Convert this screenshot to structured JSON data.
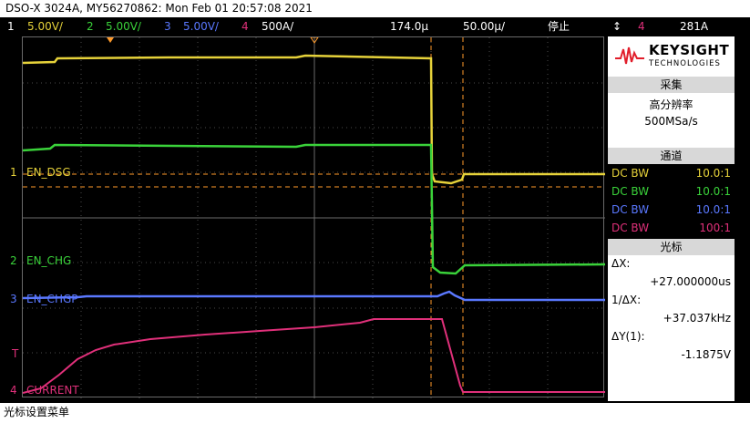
{
  "title": "DSO-X 3024A, MY56270862: Mon Feb 01 20:57:08 2021",
  "channel_bar": {
    "ch1_num": "1",
    "ch1_scale": "5.00V/",
    "ch2_num": "2",
    "ch2_scale": "5.00V/",
    "ch3_num": "3",
    "ch3_scale": "5.00V/",
    "ch4_num": "4",
    "ch4_scale": "500A/",
    "time_delay": "174.0µ",
    "time_scale": "50.00µ/",
    "run_state": "停止",
    "trigger_icon": "↕",
    "trigger_channel": "4",
    "trigger_level": "281A"
  },
  "traces": {
    "ch1": "EN_DSG",
    "ch2": "EN_CHG",
    "ch3": "EN_CHGP",
    "ch4": "CURRENT",
    "marker1": "1",
    "marker2": "2",
    "marker3": "3",
    "marker4": "4",
    "trig_marker": "T"
  },
  "brand": {
    "name": "KEYSIGHT",
    "sub": "TECHNOLOGIES"
  },
  "acquisition": {
    "header": "采集",
    "mode": "高分辨率",
    "rate": "500MSa/s"
  },
  "channels": {
    "header": "通道",
    "rows": [
      {
        "coupling": "DC BW",
        "probe": "10.0:1",
        "color": "#e6d23a"
      },
      {
        "coupling": "DC BW",
        "probe": "10.0:1",
        "color": "#3ad23a"
      },
      {
        "coupling": "DC BW",
        "probe": "10.0:1",
        "color": "#5a78ff"
      },
      {
        "coupling": "DC BW",
        "probe": "100:1",
        "color": "#e0307a"
      }
    ]
  },
  "cursors": {
    "header": "光标",
    "dx_label": "ΔX:",
    "dx_value": "+27.000000us",
    "inv_dx_label": "1/ΔX:",
    "inv_dx_value": "+37.037kHz",
    "dy_label": "ΔY(1):",
    "dy_value": "-1.1875V"
  },
  "bottom_menu": "光标设置菜单",
  "colors": {
    "ch1": "#e6d23a",
    "ch2": "#3ad23a",
    "ch3": "#5a78ff",
    "ch4": "#e0307a",
    "cursor": "#ff9a2a"
  },
  "icons": {
    "trigger": "trigger-edge-icon",
    "logo": "keysight-wave-icon"
  }
}
